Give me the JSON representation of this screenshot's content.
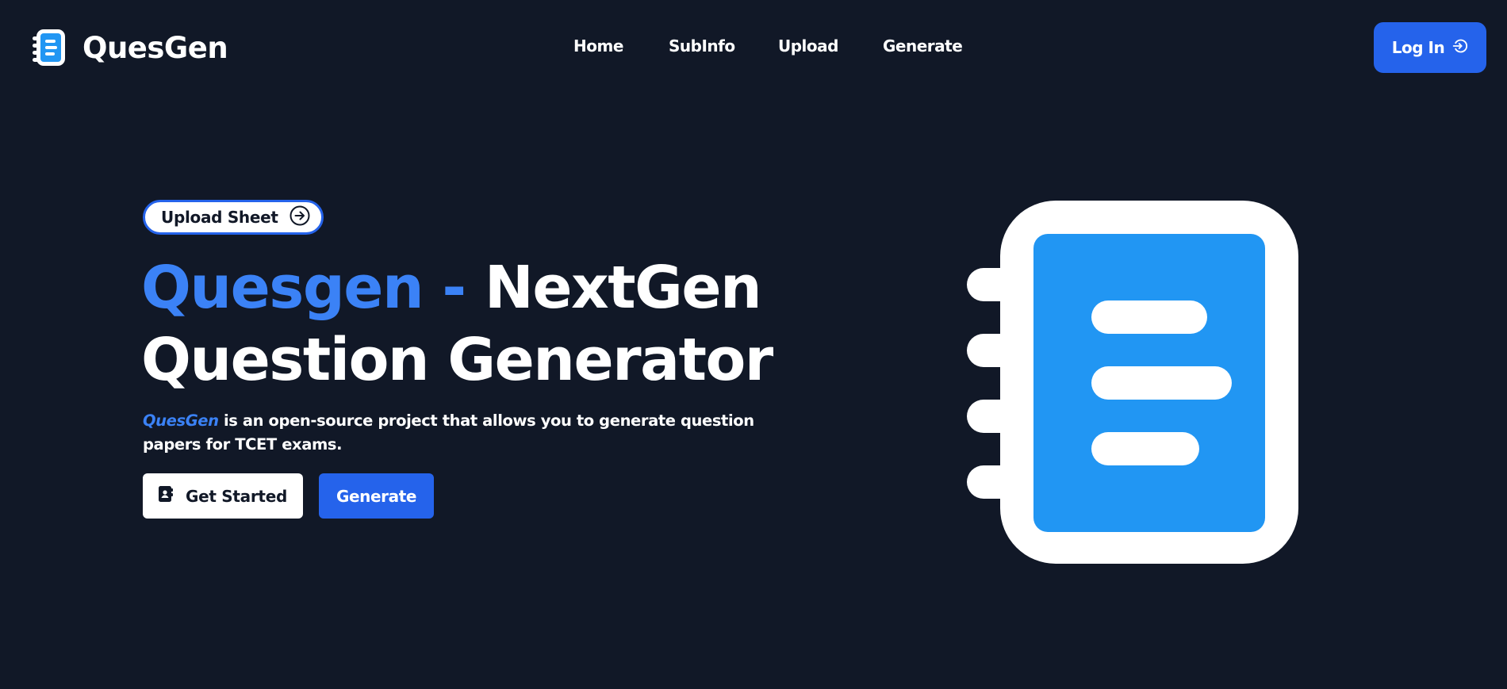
{
  "header": {
    "brand": "QuesGen",
    "nav": [
      {
        "label": "Home"
      },
      {
        "label": "SubInfo"
      },
      {
        "label": "Upload"
      },
      {
        "label": "Generate"
      }
    ],
    "login_label": "Log In"
  },
  "hero": {
    "pill_label": "Upload Sheet",
    "title_accent": "Quesgen -",
    "title_rest": "NextGen",
    "title_line2": "Question Generator",
    "desc_brand": "QuesGen",
    "desc_text": " is an open-source project that allows you to generate question papers for TCET exams.",
    "get_started_label": "Get Started",
    "generate_label": "Generate"
  },
  "icons": {
    "logo": "notebook-icon",
    "login": "log-in-icon",
    "pill": "arrow-right-circle-icon",
    "get_started": "contact-book-icon",
    "illustration": "notebook-icon"
  },
  "colors": {
    "background": "#111827",
    "accent": "#2563eb",
    "accent_text": "#3b82f6",
    "illustration_blue": "#2196f3",
    "white": "#ffffff"
  }
}
